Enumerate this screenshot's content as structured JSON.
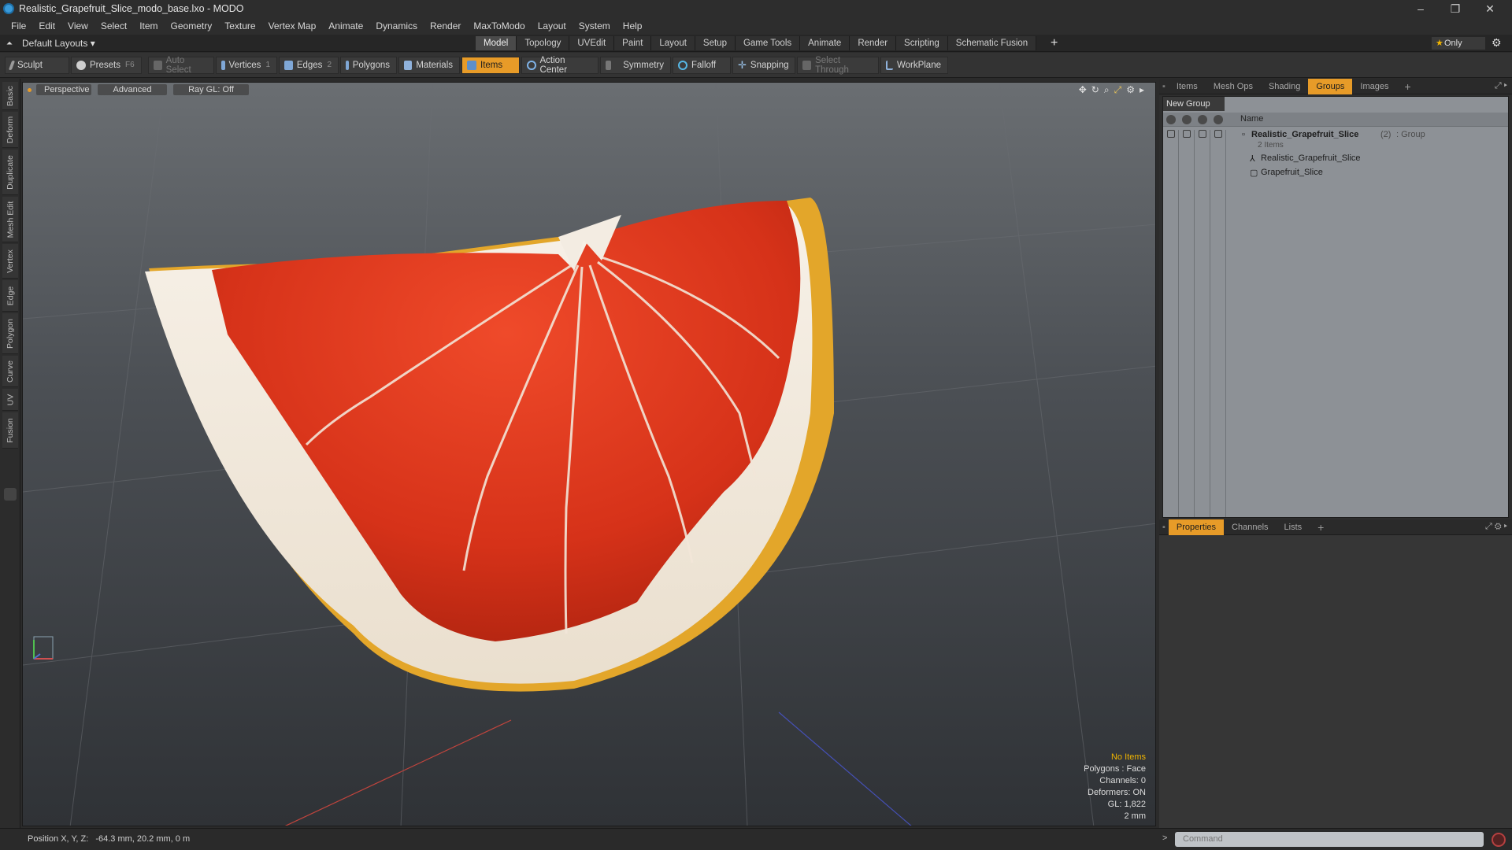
{
  "window": {
    "title": "Realistic_Grapefruit_Slice_modo_base.lxo - MODO",
    "controls": [
      "–",
      "❐",
      "✕"
    ]
  },
  "menu": [
    "File",
    "Edit",
    "View",
    "Select",
    "Item",
    "Geometry",
    "Texture",
    "Vertex Map",
    "Animate",
    "Dynamics",
    "Render",
    "MaxToModo",
    "Layout",
    "System",
    "Help"
  ],
  "layoutbar": {
    "layout_label": "Default Layouts ▾",
    "tabs": [
      "Model",
      "Topology",
      "UVEdit",
      "Paint",
      "Layout",
      "Setup",
      "Game Tools",
      "Animate",
      "Render",
      "Scripting",
      "Schematic Fusion"
    ],
    "active_tab": "Model",
    "plus": "+",
    "only_label": "Only"
  },
  "toolbar": {
    "sculpt": "Sculpt",
    "presets": "Presets",
    "presets_key": "F6",
    "auto_select": "Auto Select",
    "vertices": "Vertices",
    "vertices_key": "1",
    "edges": "Edges",
    "edges_key": "2",
    "polygons": "Polygons",
    "materials": "Materials",
    "items": "Items",
    "action_center": "Action Center",
    "symmetry": "Symmetry",
    "falloff": "Falloff",
    "snapping": "Snapping",
    "select_through": "Select Through",
    "workplane": "WorkPlane"
  },
  "left_tabs": [
    "Basic",
    "Deform",
    "Duplicate",
    "Mesh Edit",
    "Vertex",
    "Edge",
    "Polygon",
    "Curve",
    "UV",
    "Fusion"
  ],
  "viewport": {
    "view": "Perspective",
    "shading": "Advanced",
    "raygl": "Ray GL: Off",
    "stats": {
      "selection": "No Items",
      "polygons": "Polygons : Face",
      "channels": "Channels: 0",
      "deformers": "Deformers: ON",
      "gl": "GL: 1,822",
      "scale": "2 mm"
    }
  },
  "groups_panel": {
    "tabs": [
      "Items",
      "Mesh Ops",
      "Shading",
      "Groups",
      "Images"
    ],
    "active_tab": "Groups",
    "new_group": "New Group",
    "column_name": "Name",
    "group_name": "Realistic_Grapefruit_Slice",
    "group_count": "(2)",
    "group_type": ": Group",
    "group_sub": "2 Items",
    "items": [
      "Realistic_Grapefruit_Slice",
      "Grapefruit_Slice"
    ]
  },
  "properties_panel": {
    "tabs": [
      "Properties",
      "Channels",
      "Lists"
    ],
    "active_tab": "Properties"
  },
  "statusbar": {
    "position_label": "Position X, Y, Z:",
    "position_value": "-64.3 mm, 20.2 mm, 0 m",
    "command_placeholder": "Command"
  },
  "colors": {
    "accent": "#e79b28",
    "flesh": "#d9321a",
    "pith": "#f3ebe0",
    "rind": "#e3a62a"
  }
}
